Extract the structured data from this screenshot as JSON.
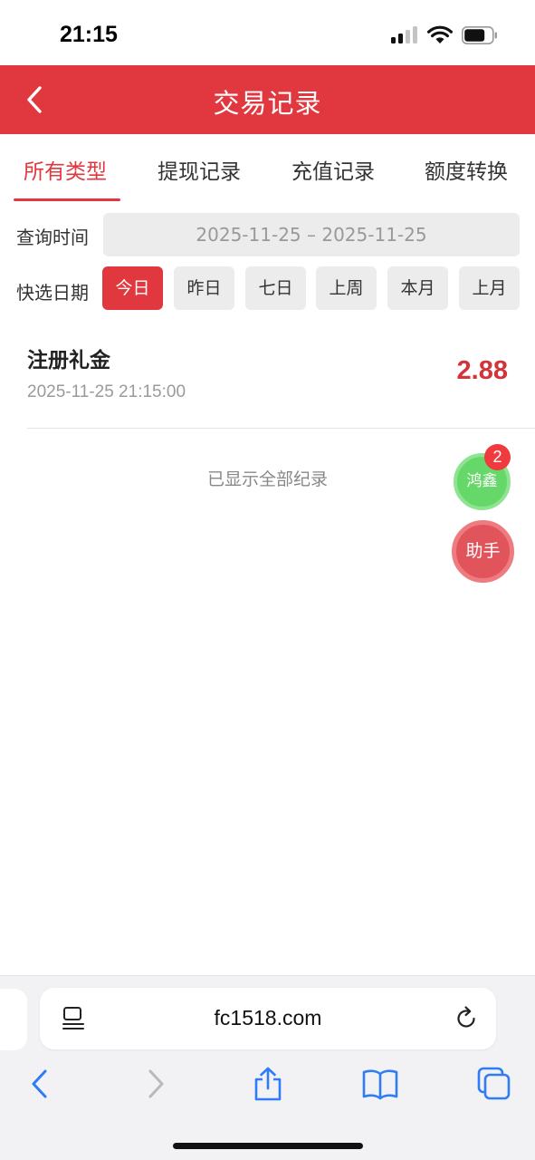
{
  "status_bar": {
    "time": "21:15"
  },
  "header": {
    "title": "交易记录"
  },
  "tabs": [
    {
      "label": "所有类型",
      "active": true
    },
    {
      "label": "提现记录",
      "active": false
    },
    {
      "label": "充值记录",
      "active": false
    },
    {
      "label": "额度转换",
      "active": false
    }
  ],
  "query": {
    "time_label": "查询时间",
    "date_range": "2025-11-25 – 2025-11-25",
    "quick_label": "快选日期",
    "quick_buttons": [
      "今日",
      "昨日",
      "七日",
      "上周",
      "本月",
      "上月"
    ],
    "active_quick": "今日"
  },
  "records": [
    {
      "title": "注册礼金",
      "time": "2025-11-25 21:15:00",
      "amount": "2.88"
    }
  ],
  "footer_text": "已显示全部纪录",
  "floating": {
    "green_label": "鸿鑫",
    "badge_count": "2",
    "red_label": "助手"
  },
  "browser": {
    "url": "fc1518.com"
  },
  "colors": {
    "accent": "#e0383e",
    "amount": "#d3343a",
    "green_bubble": "#66d86a",
    "ios_blue": "#2f7cf6"
  }
}
